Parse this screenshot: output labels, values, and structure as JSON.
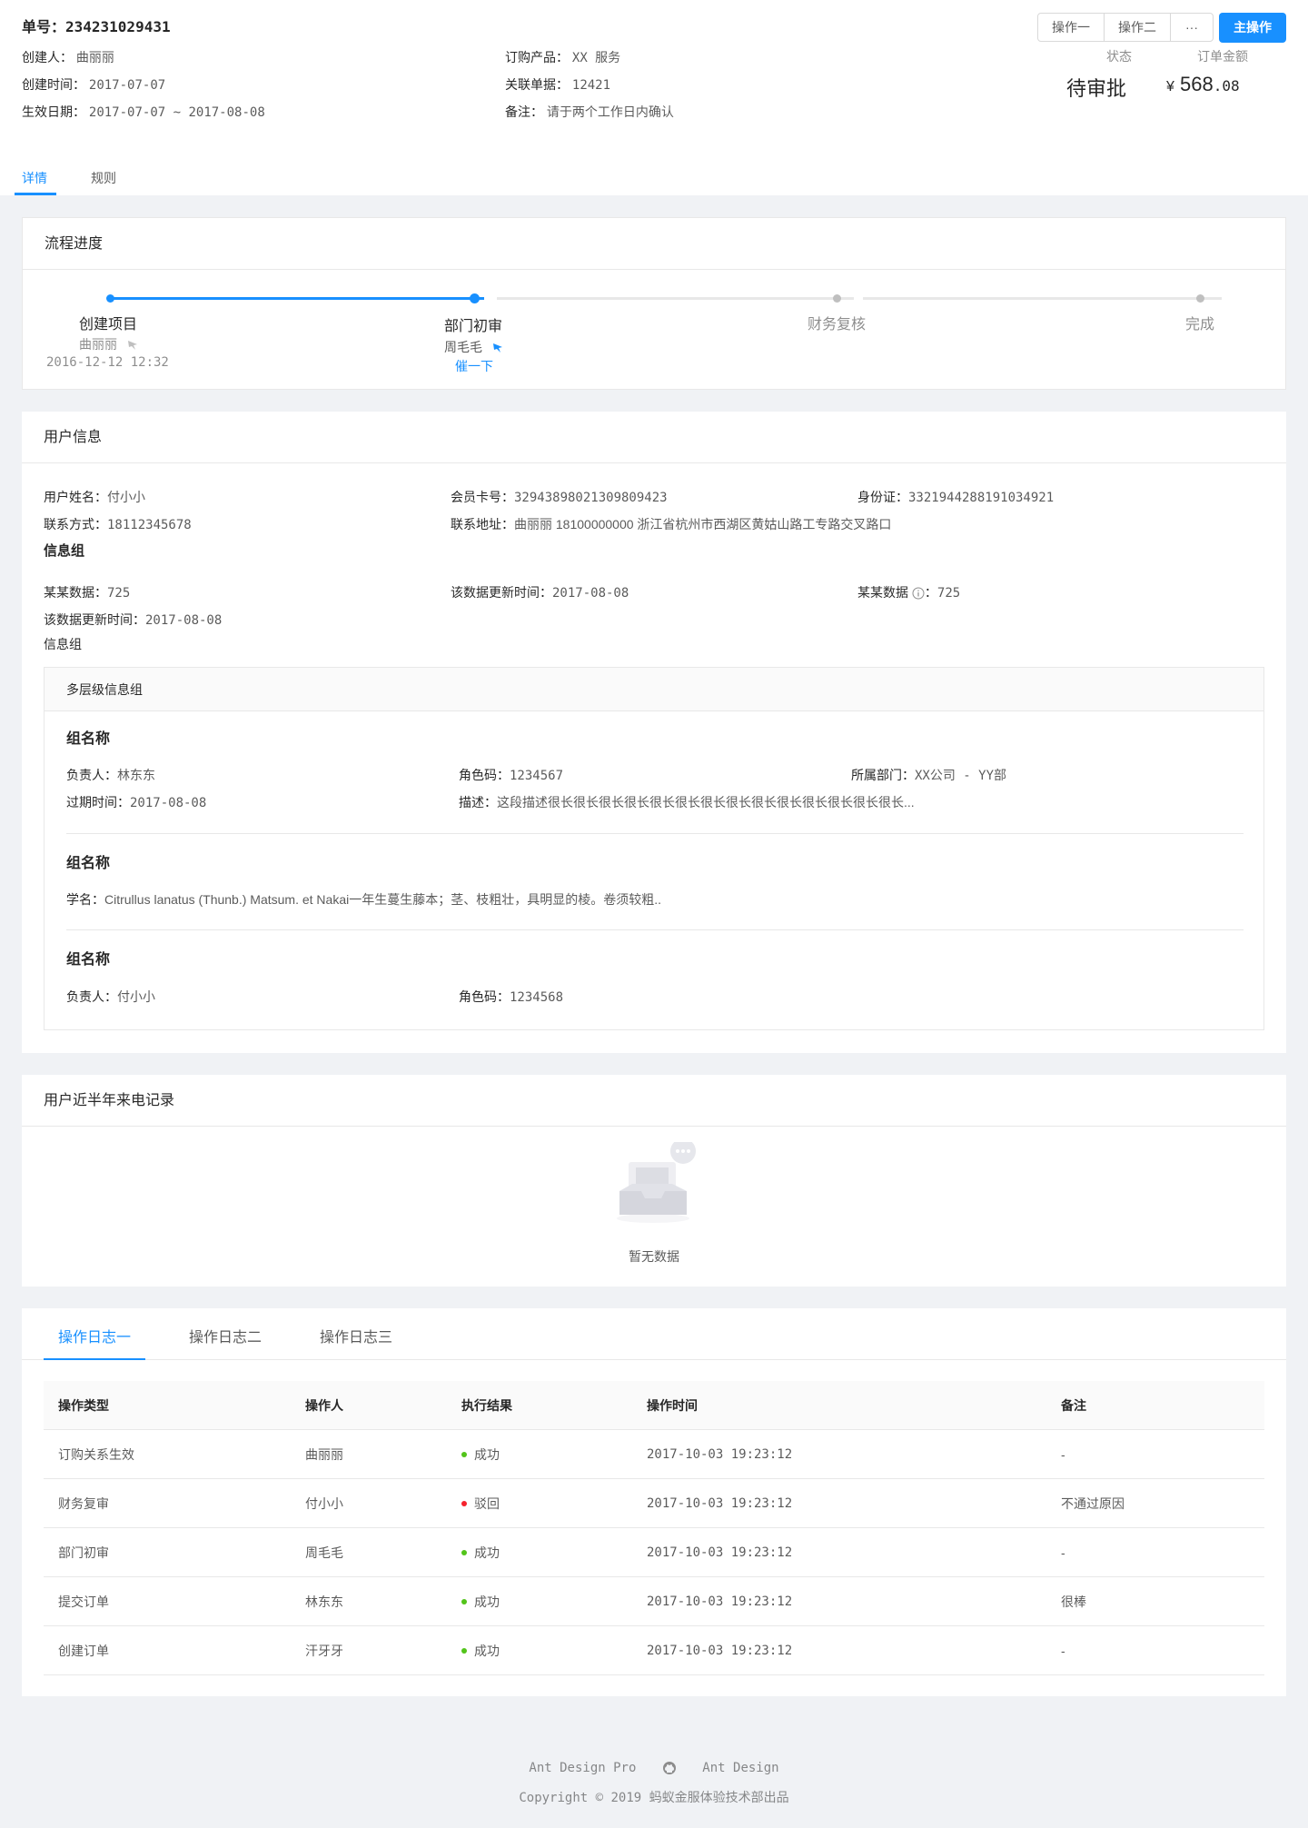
{
  "header": {
    "order_title": "单号：234231029431",
    "creator_label": "创建人：",
    "creator": "曲丽丽",
    "product_label": "订购产品：",
    "product": "XX 服务",
    "created_label": "创建时间：",
    "created": "2017-07-07",
    "related_label": "关联单据：",
    "related": "12421",
    "effective_label": "生效日期：",
    "effective": "2017-07-07 ~ 2017-08-08",
    "remark_label": "备注：",
    "remark": "请于两个工作日内确认",
    "actions": {
      "op1": "操作一",
      "op2": "操作二",
      "more": "···",
      "primary": "主操作"
    },
    "status_label": "状态",
    "status": "待审批",
    "amount_label": "订单金额",
    "amount_symbol": "¥",
    "amount_int": "568",
    "amount_dec": ".08"
  },
  "tabs": [
    "详情",
    "规则"
  ],
  "progress": {
    "title": "流程进度",
    "steps": [
      {
        "title": "创建项目",
        "person": "曲丽丽",
        "time": "2016-12-12 12:32"
      },
      {
        "title": "部门初审",
        "person": "周毛毛",
        "action": "催一下"
      },
      {
        "title": "财务复核"
      },
      {
        "title": "完成"
      }
    ]
  },
  "user_info": {
    "title": "用户信息",
    "name_label": "用户姓名：",
    "name": "付小小",
    "card_label": "会员卡号：",
    "card": "32943898021309809423",
    "id_label": "身份证：",
    "id": "3321944288191034921",
    "contact_label": "联系方式：",
    "contact": "18112345678",
    "address_label": "联系地址：",
    "address": "曲丽丽 18100000000 浙江省杭州市西湖区黄姑山路工专路交叉路口",
    "group_title": "信息组",
    "data1_label": "某某数据：",
    "data1": "725",
    "update1_label": "该数据更新时间：",
    "update1": "2017-08-08",
    "data2_label": "某某数据",
    "data2_sep": "：",
    "data2": "725",
    "update2_label": "该数据更新时间：",
    "update2": "2017-08-08",
    "group_label2": "信息组",
    "multi": {
      "title": "多层级信息组",
      "g1_title": "组名称",
      "owner_label": "负责人：",
      "owner": "林东东",
      "role_label": "角色码：",
      "role": "1234567",
      "dept_label": "所属部门：",
      "dept": "XX公司 - YY部",
      "expire_label": "过期时间：",
      "expire": "2017-08-08",
      "desc_label": "描述：",
      "desc": "这段描述很长很长很长很长很长很长很长很长很长很长很长很长很长很长...",
      "g2_title": "组名称",
      "sci_label": "学名：",
      "sci": "Citrullus lanatus (Thunb.) Matsum. et Nakai一年生蔓生藤本；茎、枝粗壮，具明显的棱。卷须较粗..",
      "g3_title": "组名称",
      "owner3_label": "负责人：",
      "owner3": "付小小",
      "role3_label": "角色码：",
      "role3": "1234568"
    }
  },
  "calls": {
    "title": "用户近半年来电记录",
    "empty": "暂无数据"
  },
  "logs": {
    "tabs": [
      "操作日志一",
      "操作日志二",
      "操作日志三"
    ],
    "columns": [
      "操作类型",
      "操作人",
      "执行结果",
      "操作时间",
      "备注"
    ],
    "rows": [
      {
        "type": "订购关系生效",
        "operator": "曲丽丽",
        "result": "成功",
        "status": "success",
        "time": "2017-10-03 19:23:12",
        "memo": "-"
      },
      {
        "type": "财务复审",
        "operator": "付小小",
        "result": "驳回",
        "status": "error",
        "time": "2017-10-03 19:23:12",
        "memo": "不通过原因"
      },
      {
        "type": "部门初审",
        "operator": "周毛毛",
        "result": "成功",
        "status": "success",
        "time": "2017-10-03 19:23:12",
        "memo": "-"
      },
      {
        "type": "提交订单",
        "operator": "林东东",
        "result": "成功",
        "status": "success",
        "time": "2017-10-03 19:23:12",
        "memo": "很棒"
      },
      {
        "type": "创建订单",
        "operator": "汗牙牙",
        "result": "成功",
        "status": "success",
        "time": "2017-10-03 19:23:12",
        "memo": "-"
      }
    ]
  },
  "footer": {
    "link1": "Ant Design Pro",
    "github_icon": "github-icon",
    "link2": "Ant Design",
    "copyright": "Copyright © 2019 蚂蚁金服体验技术部出品"
  },
  "colors": {
    "primary": "#1890ff",
    "success": "#52c41a",
    "error": "#f5222d",
    "background": "#f0f2f5"
  }
}
